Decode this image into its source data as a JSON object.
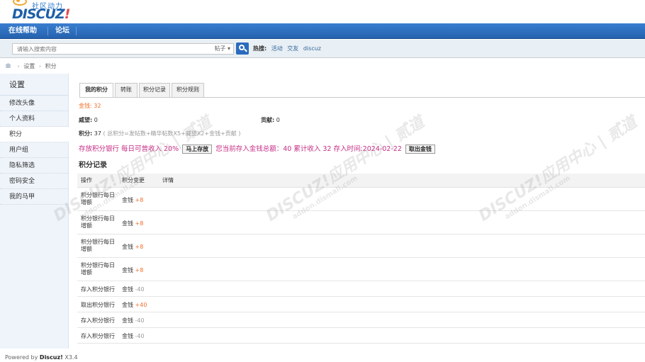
{
  "logo": {
    "slogan": "社区动力",
    "brand_main": "DISCUZ",
    "brand_mark": "!"
  },
  "nav": {
    "items": [
      "在线帮助",
      "论坛"
    ]
  },
  "search": {
    "placeholder": "请输入搜索内容",
    "scope": "帖子",
    "hot_label": "热搜:",
    "hot_keywords": [
      "活动",
      "交友",
      "discuz"
    ]
  },
  "breadcrumb": {
    "items": [
      "设置",
      "积分"
    ]
  },
  "sidebar": {
    "title": "设置",
    "items": [
      "修改头像",
      "个人资料",
      "积分",
      "用户组",
      "隐私筛选",
      "密码安全",
      "我的马甲"
    ]
  },
  "tabs": [
    "我的积分",
    "转账",
    "积分记录",
    "积分规则"
  ],
  "credits": {
    "money_label": "金钱:",
    "money_value": "32",
    "prestige_label": "威望:",
    "prestige_value": "0",
    "contrib_label": "贡献:",
    "contrib_value": "0",
    "points_label": "积分:",
    "points_value": "37",
    "points_formula": "( 总积分=发帖数+精华帖数X5+威望X2+金钱+贡献 )"
  },
  "bank": {
    "text1": "存放积分银行 每日可曾收入 20%",
    "deposit_button": "马上存放",
    "text2": "您当前存入金钱总额：40 累计收入 32 存入时间:2024-02-22",
    "withdraw_button": "取出金钱"
  },
  "records": {
    "title": "积分记录",
    "headers": [
      "操作",
      "积分变更",
      "详情"
    ],
    "rows": [
      {
        "op": "积分银行每日增额",
        "type": "金钱",
        "change": "+8"
      },
      {
        "op": "积分银行每日增额",
        "type": "金钱",
        "change": "+8"
      },
      {
        "op": "积分银行每日增额",
        "type": "金钱",
        "change": "+8"
      },
      {
        "op": "积分银行每日增额",
        "type": "金钱",
        "change": "+8"
      },
      {
        "op": "存入积分银行",
        "type": "金钱",
        "change": "-40"
      },
      {
        "op": "取出积分银行",
        "type": "金钱",
        "change": "+40"
      },
      {
        "op": "存入积分银行",
        "type": "金钱",
        "change": "-40"
      },
      {
        "op": "存入积分银行",
        "type": "金钱",
        "change": "-40"
      }
    ]
  },
  "watermark": {
    "main": "DISCUZ!应用中心 | 贰道",
    "site": "addon.dismall.com"
  },
  "footer": {
    "prefix": "Powered by",
    "brand": "Discuz!",
    "version": "X3.4"
  }
}
